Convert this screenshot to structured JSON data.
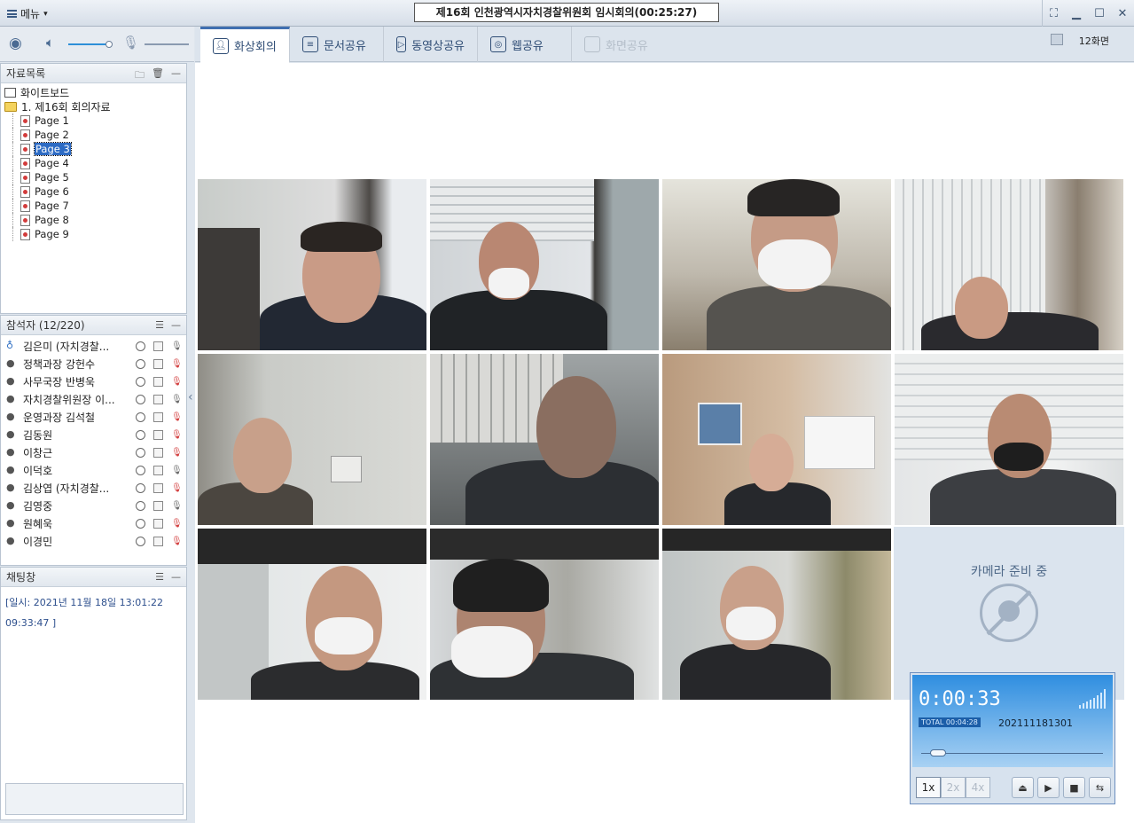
{
  "window": {
    "menu_label": "메뉴",
    "title": "제16회 인천광역시자치경찰위원회 임시회의(00:25:27)"
  },
  "tabs": [
    {
      "label": "화상회의",
      "icon": "video-conference-icon",
      "active": true
    },
    {
      "label": "문서공유",
      "icon": "document-share-icon",
      "active": false
    },
    {
      "label": "동영상공유",
      "icon": "video-share-icon",
      "active": false
    },
    {
      "label": "웹공유",
      "icon": "web-share-icon",
      "active": false
    },
    {
      "label": "화면공유",
      "icon": "screen-share-icon",
      "active": false,
      "disabled": true
    }
  ],
  "layout_selector": {
    "label": "12화면"
  },
  "files_panel": {
    "title": "자료목록",
    "whiteboard": "화이트보드",
    "folder": "1. 제16회 회의자료",
    "pages": [
      "Page 1",
      "Page 2",
      "Page 3",
      "Page 4",
      "Page 5",
      "Page 6",
      "Page 7",
      "Page 8",
      "Page 9"
    ],
    "selected_page": "Page 3"
  },
  "participants_panel": {
    "title": "참석자 (12/220)",
    "participants": [
      {
        "name": "김은미 (자치경찰...",
        "host": true,
        "mic_muted": false
      },
      {
        "name": "정책과장 강헌수",
        "host": false,
        "mic_muted": true
      },
      {
        "name": "사무국장 반병욱",
        "host": false,
        "mic_muted": true
      },
      {
        "name": "자치경찰위원장 이...",
        "host": false,
        "mic_muted": false
      },
      {
        "name": "운영과장 김석철",
        "host": false,
        "mic_muted": true
      },
      {
        "name": "김동원",
        "host": false,
        "mic_muted": true
      },
      {
        "name": "이창근",
        "host": false,
        "mic_muted": true
      },
      {
        "name": "이덕호",
        "host": false,
        "mic_muted": false
      },
      {
        "name": "김상엽 (자치경찰...",
        "host": false,
        "mic_muted": true
      },
      {
        "name": "김영중",
        "host": false,
        "mic_muted": false
      },
      {
        "name": "원혜욱",
        "host": false,
        "mic_muted": true
      },
      {
        "name": "이경민",
        "host": false,
        "mic_muted": true
      }
    ]
  },
  "chat_panel": {
    "title": "채팅창",
    "line1": "[일시: 2021년 11월 18일 13:01:22",
    "line2": "09:33:47 ]"
  },
  "camera_standby": {
    "text": "카메라 준비 중"
  },
  "player": {
    "elapsed": "0:00:33",
    "total": "TOTAL 00:04:28",
    "recording_id": "202111181301",
    "speeds": [
      "1x",
      "2x",
      "4x"
    ],
    "active_speed": "1x"
  },
  "colors": {
    "accent": "#3f6fb0",
    "chat_text": "#2d4f8d",
    "mute_red": "#d23b3b"
  }
}
